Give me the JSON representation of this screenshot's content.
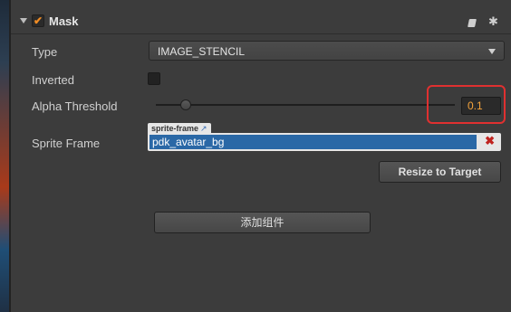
{
  "component": {
    "title": "Mask",
    "enabled": true
  },
  "type_row": {
    "label": "Type",
    "value": "IMAGE_STENCIL"
  },
  "inverted_row": {
    "label": "Inverted",
    "checked": false
  },
  "alpha_row": {
    "label": "Alpha Threshold",
    "value": "0.1",
    "fraction": 0.1
  },
  "sprite_row": {
    "label": "Sprite Frame",
    "asset_type": "sprite-frame",
    "asset_value": "pdk_avatar_bg",
    "clear_glyph": "✖"
  },
  "buttons": {
    "resize": "Resize to Target",
    "add_component": "添加组件"
  },
  "colors": {
    "accent_orange": "#f08c24",
    "highlight_red": "#e03030",
    "selection_blue": "#2a68a6"
  }
}
